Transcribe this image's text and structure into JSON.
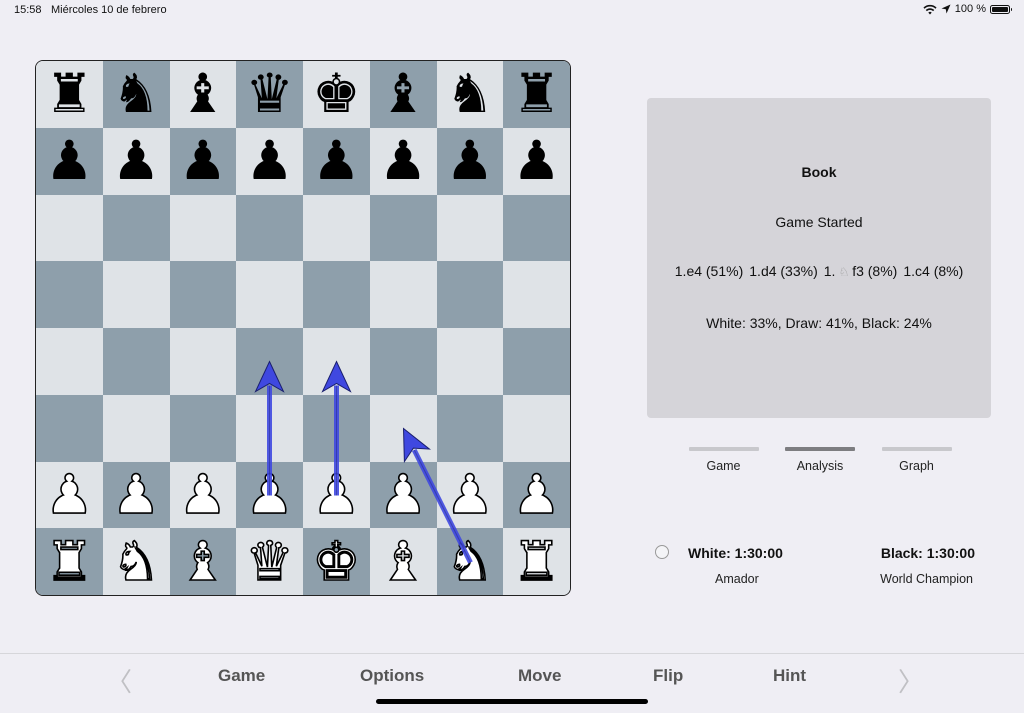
{
  "status_bar": {
    "time": "15:58",
    "date": "Miércoles 10 de febrero",
    "battery_text": "100 %",
    "icons": [
      "wifi-icon",
      "location-arrow-icon",
      "battery-icon"
    ]
  },
  "board": {
    "orientation": "white-bottom",
    "colors": {
      "light": "#dfe3e7",
      "dark": "#8e9fab",
      "arrow": "#3f48e0"
    },
    "ranks": [
      [
        "bR",
        "bN",
        "bB",
        "bQ",
        "bK",
        "bB",
        "bN",
        "bR"
      ],
      [
        "bP",
        "bP",
        "bP",
        "bP",
        "bP",
        "bP",
        "bP",
        "bP"
      ],
      [
        "",
        "",
        "",
        "",
        "",
        "",
        "",
        ""
      ],
      [
        "",
        "",
        "",
        "",
        "",
        "",
        "",
        ""
      ],
      [
        "",
        "",
        "",
        "",
        "",
        "",
        "",
        ""
      ],
      [
        "",
        "",
        "",
        "",
        "",
        "",
        "",
        ""
      ],
      [
        "wP",
        "wP",
        "wP",
        "wP",
        "wP",
        "wP",
        "wP",
        "wP"
      ],
      [
        "wR",
        "wN",
        "wB",
        "wQ",
        "wK",
        "wB",
        "wN",
        "wR"
      ]
    ],
    "piece_glyphs": {
      "K": "♚",
      "Q": "♛",
      "R": "♜",
      "B": "♝",
      "N": "♞",
      "P": "♟"
    },
    "arrows": [
      {
        "from": "d2",
        "to": "d4"
      },
      {
        "from": "e2",
        "to": "e4"
      },
      {
        "from": "g1",
        "to": "f3"
      }
    ]
  },
  "book": {
    "title": "Book",
    "status": "Game Started",
    "moves": [
      {
        "prefix": "1.",
        "piece_icon": "",
        "move": "e4",
        "pct": "(51%)"
      },
      {
        "prefix": "1.",
        "piece_icon": "",
        "move": "d4",
        "pct": "(33%)"
      },
      {
        "prefix": "1.",
        "piece_icon": "♘",
        "move": "f3",
        "pct": "(8%)"
      },
      {
        "prefix": "1.",
        "piece_icon": "",
        "move": "c4",
        "pct": "(8%)"
      }
    ],
    "stats": "White: 33%, Draw: 41%, Black: 24%"
  },
  "tabs": [
    {
      "label": "Game",
      "active": false
    },
    {
      "label": "Analysis",
      "active": true
    },
    {
      "label": "Graph",
      "active": false
    }
  ],
  "players": {
    "white_clock": "White: 1:30:00",
    "white_name": "Amador",
    "black_clock": "Black: 1:30:00",
    "black_name": "World Champion",
    "to_move_indicator": "white"
  },
  "toolbar": {
    "prev_icon": "chevron-left-icon",
    "next_icon": "chevron-right-icon",
    "buttons": [
      "Game",
      "Options",
      "Move",
      "Flip",
      "Hint"
    ]
  }
}
